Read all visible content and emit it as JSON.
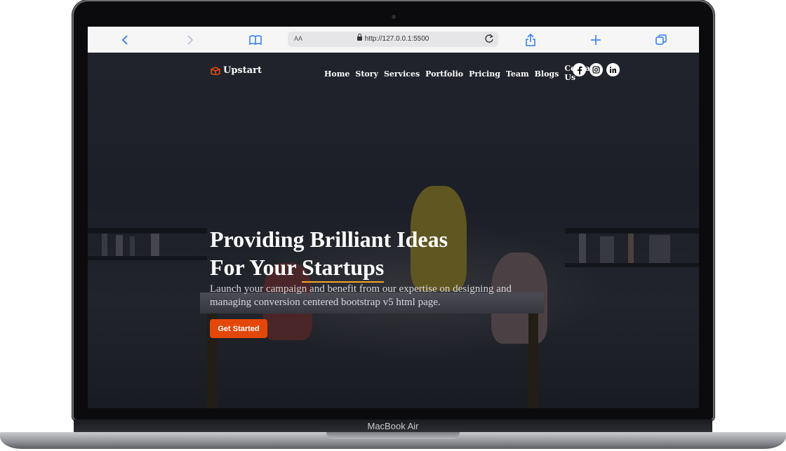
{
  "device": {
    "label": "MacBook Air"
  },
  "browser": {
    "text_size_label": "AA",
    "url": "http://127.0.0.1:5500"
  },
  "site": {
    "brand": "Upstart",
    "brand_color": "#e4470a",
    "nav": [
      "Home",
      "Story",
      "Services",
      "Portfolio",
      "Pricing",
      "Team",
      "Blogs",
      "Contact Us"
    ],
    "socials": [
      "facebook-icon",
      "instagram-icon",
      "linkedin-icon"
    ]
  },
  "hero": {
    "title_line1": "Providing Brilliant Ideas",
    "title_line2_prefix": "For Your ",
    "title_line2_highlight": "Startups",
    "subtitle": "Launch your campaign and benefit from our expertise on designing and managing conversion centered bootstrap v5 html page.",
    "cta_label": "Get Started",
    "accent_underline_color": "#f4a52a"
  }
}
